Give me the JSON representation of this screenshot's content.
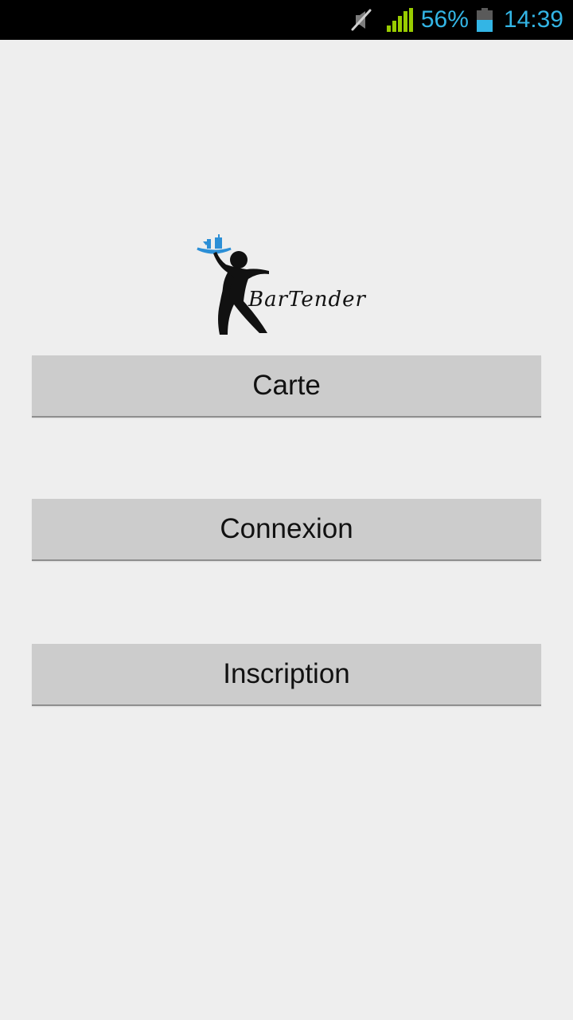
{
  "status_bar": {
    "battery_percent": "56%",
    "time": "14:39",
    "icons": [
      "mute-icon",
      "signal-icon",
      "battery-icon"
    ],
    "accent_color": "#33b5e5",
    "signal_color": "#99cc00"
  },
  "logo": {
    "wordmark": "BarTender",
    "icon": "waiter-with-tray-logo"
  },
  "buttons": {
    "carte": "Carte",
    "connexion": "Connexion",
    "inscription": "Inscription"
  }
}
